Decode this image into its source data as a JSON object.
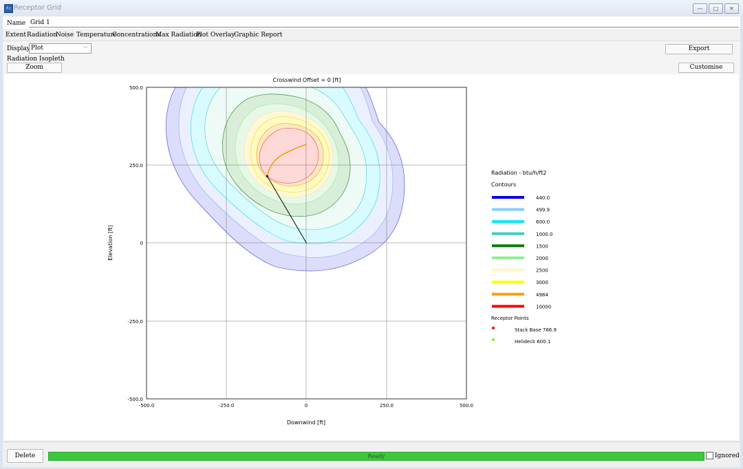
{
  "window": {
    "title": "Receptor Grid",
    "icon": "app-icon"
  },
  "name": {
    "label": "Name",
    "value": "Grid 1"
  },
  "menu": [
    "Extent",
    "Radiation",
    "Noise",
    "Temperature",
    "Concentrations",
    "Max Radiation",
    "Plot Overlay",
    "Graphic Report"
  ],
  "toolbar": {
    "display_label": "Display",
    "display_value": "Plot",
    "export_label": "Export",
    "isopleth_label": "Radiation Isopleth",
    "zoom_label": "Zoom",
    "customise_label": "Customise"
  },
  "footer": {
    "delete_label": "Delete",
    "status": "Ready",
    "progress": 1.0,
    "ignored_label": "Ignored"
  },
  "chart_data": {
    "type": "contour",
    "title": "Crosswind Offset = 0 [ft]",
    "xlabel": "Downwind [ft]",
    "ylabel": "Elevation [ft]",
    "xlim": [
      -500,
      500
    ],
    "ylim": [
      -500,
      500
    ],
    "xticks": [
      "-500.0",
      "-250.0",
      "0",
      "250.0",
      "500.0"
    ],
    "yticks": [
      "500.0",
      "250.0",
      "0",
      "-250.0",
      "-500.0"
    ],
    "grid": true,
    "legend_title": "Radiation - btu/h/ft2",
    "legend_contours_label": "Contours",
    "contours": [
      {
        "label": "440.0",
        "color": "#0000e8"
      },
      {
        "label": "499.9",
        "color": "#87cefa"
      },
      {
        "label": "600.0",
        "color": "#00e8f0"
      },
      {
        "label": "1000.0",
        "color": "#40ccc4"
      },
      {
        "label": "1500",
        "color": "#007a00"
      },
      {
        "label": "2000",
        "color": "#90ee90"
      },
      {
        "label": "2500",
        "color": "#fff5cc"
      },
      {
        "label": "3000",
        "color": "#ffff00"
      },
      {
        "label": "4984",
        "color": "#ffa000"
      },
      {
        "label": "10000",
        "color": "#ff0000"
      }
    ],
    "receptor_points_label": "Receptor Points",
    "receptor_points": [
      {
        "label": "Stack Base  766.9",
        "color": "#ff0000"
      },
      {
        "label": "Helideck  600.1",
        "color": "#80ee20"
      }
    ],
    "flame_base": {
      "x": 0,
      "y": 0
    },
    "flame_tip": {
      "x": -123,
      "y": 215
    }
  }
}
